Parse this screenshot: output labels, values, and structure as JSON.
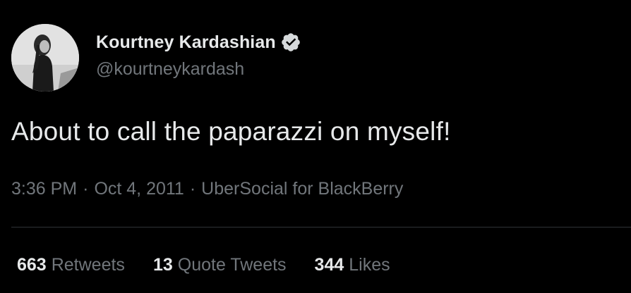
{
  "tweet": {
    "author": {
      "display_name": "Kourtney Kardashian",
      "handle": "@kourtneykardash",
      "verified_icon": "verified-badge-icon",
      "avatar": "profile-photo"
    },
    "text": "About to call the paparazzi on myself!",
    "meta": {
      "time": "3:36 PM",
      "separator": "·",
      "date": "Oct 4, 2011",
      "source": "UberSocial for BlackBerry"
    },
    "stats": {
      "retweets_count": "663",
      "retweets_label": "Retweets",
      "quote_tweets_count": "13",
      "quote_tweets_label": "Quote Tweets",
      "likes_count": "344",
      "likes_label": "Likes"
    }
  },
  "colors": {
    "background": "#000000",
    "primary_text": "#e7e9ea",
    "secondary_text": "#71767b",
    "divider": "#2f3336"
  }
}
